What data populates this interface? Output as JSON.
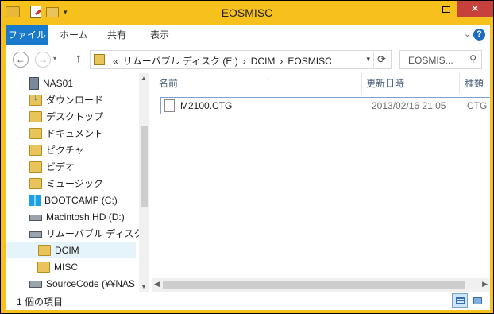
{
  "window": {
    "title": "EOSMISC"
  },
  "ribbon": {
    "tabs": [
      "ファイル",
      "ホーム",
      "共有",
      "表示"
    ]
  },
  "address": {
    "crumbs": [
      "«",
      "リムーバブル ディスク (E:)",
      "›",
      "DCIM",
      "›",
      "EOSMISC"
    ]
  },
  "search": {
    "value": "EOSMIS..."
  },
  "nav": {
    "items": [
      {
        "label": "NAS01",
        "icon": "network-computer-icon"
      },
      {
        "label": "ダウンロード",
        "icon": "downloads-folder-icon"
      },
      {
        "label": "デスクトップ",
        "icon": "desktop-folder-icon"
      },
      {
        "label": "ドキュメント",
        "icon": "documents-folder-icon"
      },
      {
        "label": "ピクチャ",
        "icon": "pictures-folder-icon"
      },
      {
        "label": "ビデオ",
        "icon": "videos-folder-icon"
      },
      {
        "label": "ミュージック",
        "icon": "music-folder-icon"
      },
      {
        "label": "BOOTCAMP (C:)",
        "icon": "windows-drive-icon"
      },
      {
        "label": "Macintosh HD (D:)",
        "icon": "drive-icon"
      },
      {
        "label": "リムーバブル ディスク (E",
        "icon": "removable-drive-icon"
      },
      {
        "label": "DCIM",
        "icon": "folder-icon"
      },
      {
        "label": "MISC",
        "icon": "folder-icon"
      },
      {
        "label": "SourceCode (¥¥NAS",
        "icon": "network-drive-icon"
      }
    ]
  },
  "files": {
    "columns": {
      "name": "名前",
      "date": "更新日時",
      "type": "種類"
    },
    "rows": [
      {
        "name": "M2100.CTG",
        "date": "2013/02/16 21:05",
        "type": "CTG"
      }
    ]
  },
  "status": {
    "count": "1 個の項目"
  },
  "colors": {
    "title_bar": "#f6c11c",
    "file_tab": "#1979ca",
    "selection": "#e5f3fb",
    "close": "#c7403b"
  }
}
